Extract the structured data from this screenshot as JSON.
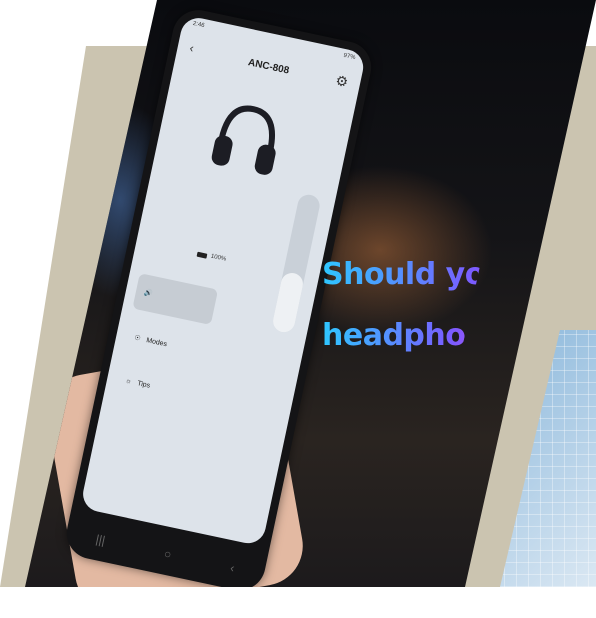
{
  "headline": {
    "line1": "Should you insta",
    "line2": "headphone ap"
  },
  "phone": {
    "status_left": "2:46",
    "status_right": "97%",
    "app_title": "ANC-808",
    "battery_level": "100%",
    "menu": {
      "volume_icon": "volume-icon",
      "modes_label": "Modes",
      "tips_label": "Tips"
    }
  },
  "colors": {
    "beige": "#cbc4b0",
    "headline_gradient_start": "#2ec7ff",
    "headline_gradient_end": "#ff3ad1"
  }
}
